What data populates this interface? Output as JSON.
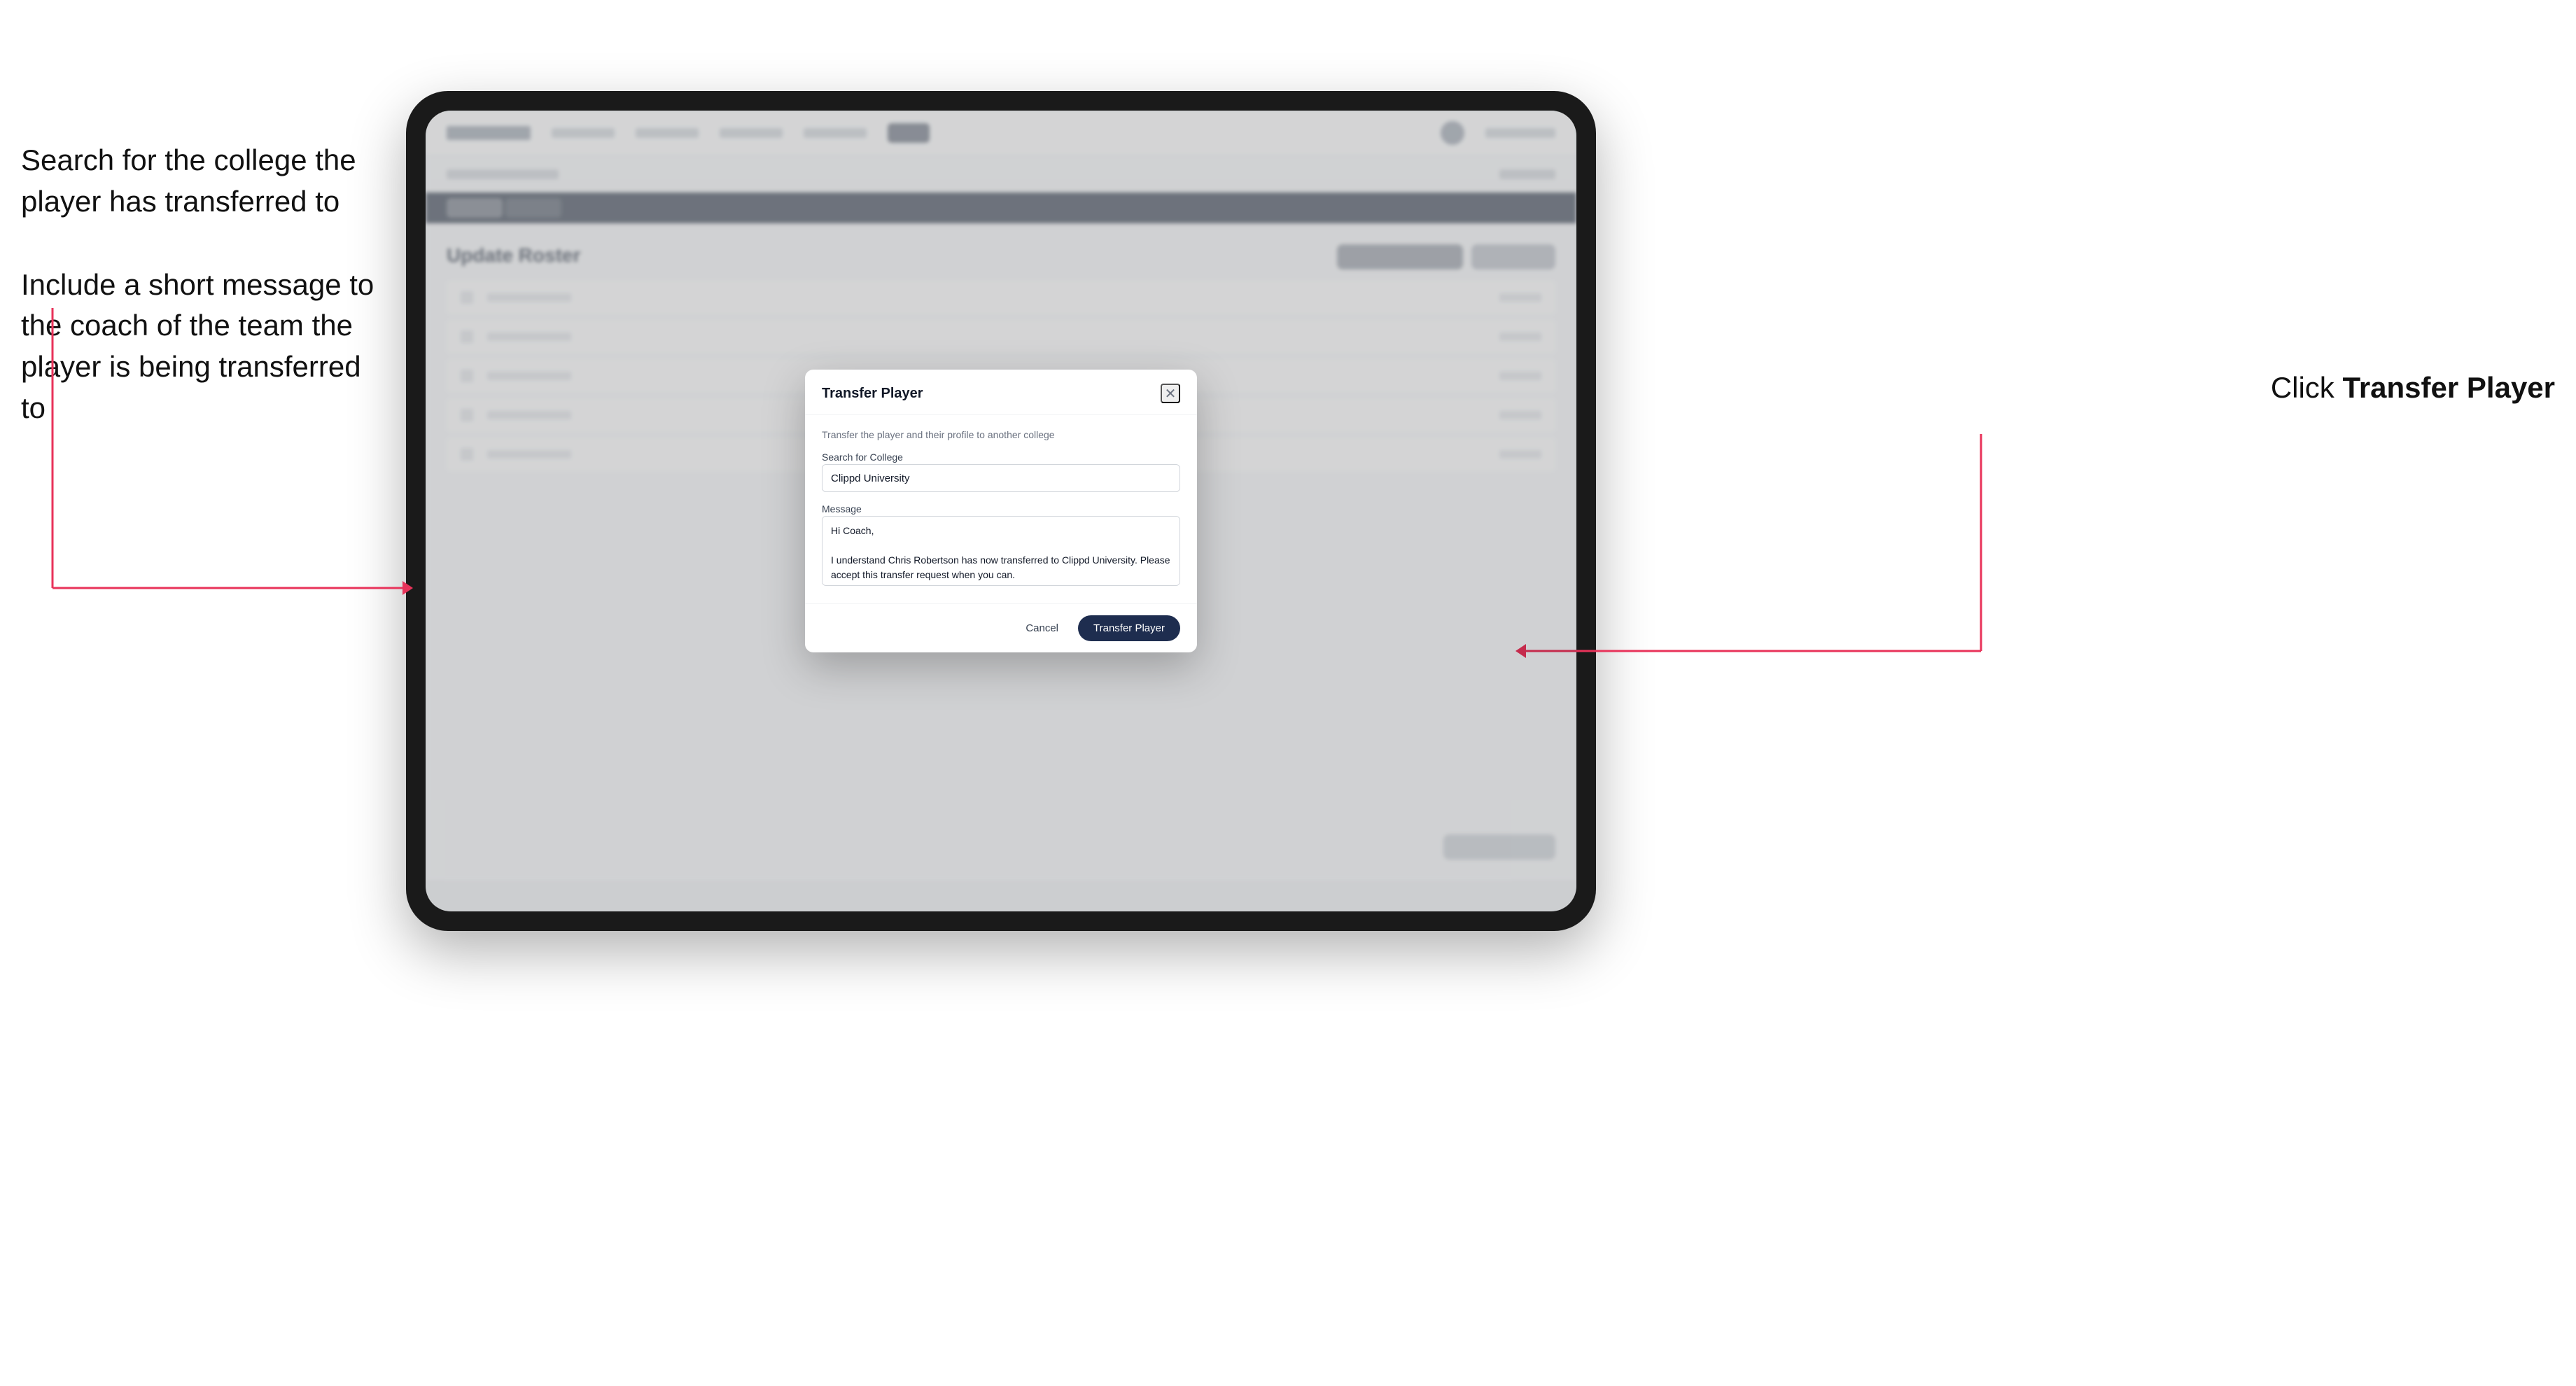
{
  "annotations": {
    "left_text_1": "Search for the college the player has transferred to",
    "left_text_2": "Include a short message to the coach of the team the player is being transferred to",
    "right_text": "Click ",
    "right_text_bold": "Transfer Player"
  },
  "modal": {
    "title": "Transfer Player",
    "subtitle": "Transfer the player and their profile to another college",
    "search_label": "Search for College",
    "search_value": "Clippd University",
    "message_label": "Message",
    "message_value": "Hi Coach,\n\nI understand Chris Robertson has now transferred to Clippd University. Please accept this transfer request when you can.",
    "cancel_label": "Cancel",
    "transfer_label": "Transfer Player"
  },
  "app": {
    "section_title": "Update Roster"
  }
}
